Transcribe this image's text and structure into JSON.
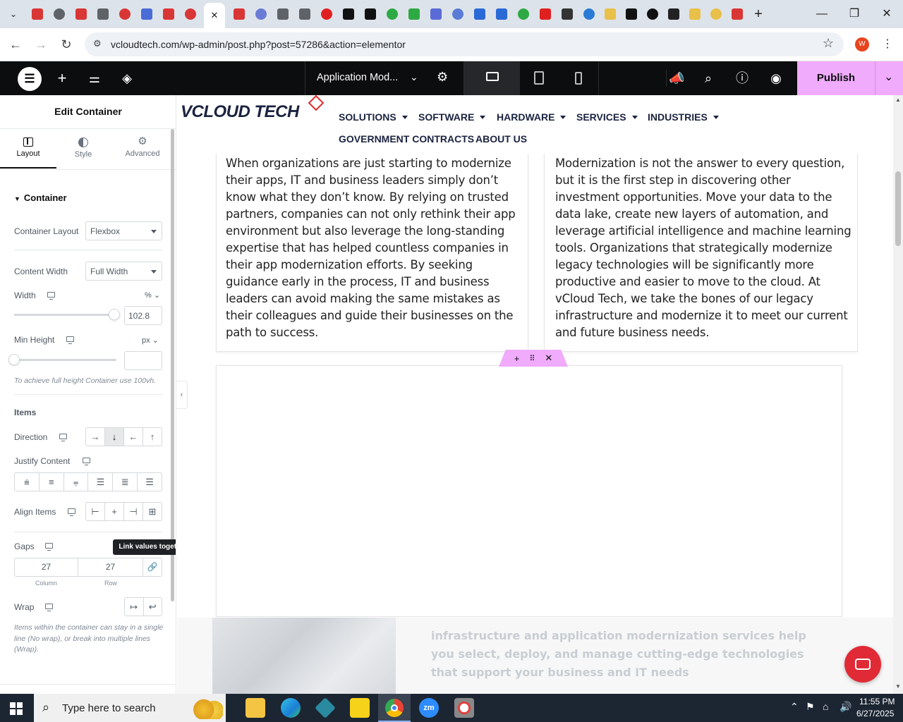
{
  "browser": {
    "url": "vcloudtech.com/wp-admin/post.php?post=57286&action=elementor",
    "profile_initial": "W",
    "tab_favicon_colors": [
      "#d93636",
      "#5f6368",
      "#d93636",
      "#5f6368",
      "#d93636",
      "#4b6bd6",
      "#d93636",
      "#d93636",
      "#ffffff",
      "#d93636",
      "#6a7bd6",
      "#5f6368",
      "#5f6368",
      "#e02020",
      "#111111",
      "#111111",
      "#2eaa44",
      "#2eaa44",
      "#5a6ad6",
      "#5a7bd6",
      "#2a6ad6",
      "#2a6ad6",
      "#2eaa44",
      "#e02020",
      "#333333",
      "#2a7bd6",
      "#e8c04a",
      "#111111",
      "#111111",
      "#222222",
      "#e8c04a",
      "#e8c04a",
      "#d93636"
    ]
  },
  "elementor": {
    "page_title": "Application Mod...",
    "publish_label": "Publish",
    "panel": {
      "title": "Edit Container",
      "tabs": [
        {
          "label": "Layout",
          "icon": "layout-icon"
        },
        {
          "label": "Style",
          "icon": "contrast-icon"
        },
        {
          "label": "Advanced",
          "icon": "gear-icon"
        }
      ],
      "section_title": "Container",
      "container_layout": {
        "label": "Container Layout",
        "value": "Flexbox"
      },
      "content_width": {
        "label": "Content Width",
        "value": "Full Width"
      },
      "width": {
        "label": "Width",
        "unit": "%",
        "value": "102.8",
        "slider_fraction": 0.98
      },
      "min_height": {
        "label": "Min Height",
        "unit": "px",
        "value": "",
        "slider_fraction": 0
      },
      "min_height_hint": "To achieve full height Container use 100vh.",
      "items_heading": "Items",
      "direction_label": "Direction",
      "justify_label": "Justify Content",
      "align_label": "Align Items",
      "gaps": {
        "label": "Gaps",
        "column": "27",
        "row": "27",
        "column_caption": "Column",
        "row_caption": "Row",
        "tooltip": "Link values together"
      },
      "wrap_label": "Wrap",
      "wrap_hint": "Items within the container can stay in a single line (No wrap), or break into multiple lines (Wrap)."
    }
  },
  "site": {
    "logo_text": "VCLOUD TECH",
    "nav": [
      "SOLUTIONS",
      "SOFTWARE",
      "HARDWARE",
      "SERVICES",
      "INDUSTRIES",
      "GOVERNMENT CONTRACTS",
      "ABOUT US"
    ],
    "left_paragraph": "When organizations are just starting to modernize their apps, IT and business leaders simply don’t know what they don’t know. By relying on trusted partners, companies can not only rethink their app environment but also leverage the long-standing expertise that has helped countless companies in their app modernization efforts. By seeking guidance early in the process, IT and business leaders can avoid making the same mistakes as their colleagues and guide their businesses on the path to success.",
    "right_paragraph": "Modernization is not the answer to every question, but it is the first step in discovering other investment opportunities. Move your data to the data lake, create new layers of automation, and leverage artificial intelligence and machine learning tools. Organizations that strategically modernize legacy technologies will be significantly more productive and easier to move to the cloud. At vCloud Tech, we take the bones of our legacy infrastructure and modernize it to meet our current and future business needs.",
    "bottom_text": "infrastructure and application modernization services help you select, deploy, and manage cutting-edge technologies that support your business and IT needs"
  },
  "taskbar": {
    "search_placeholder": "Type here to search",
    "time": "11:55 PM",
    "date": "6/27/2025"
  }
}
